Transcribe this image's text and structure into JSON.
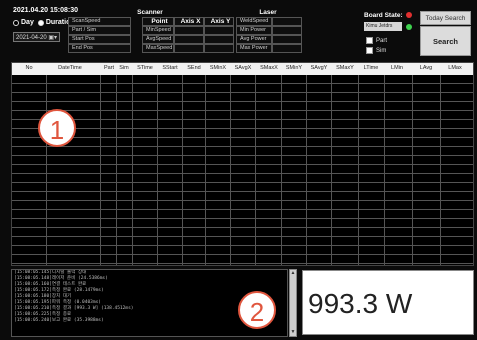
{
  "header": {
    "datetime": "2021.04.20 15:08:30",
    "mode_day": "Day",
    "mode_duration": "Duration",
    "date_value": "2021-04-20"
  },
  "scanner": {
    "title": "Scanner",
    "labels": [
      "ScanSpeed",
      "Part / Sim",
      "Start Pos",
      "End Pos"
    ],
    "col_point": "Point",
    "col_axisx": "Axis X",
    "col_axisy": "Axis Y",
    "speeds": [
      "MinSpeed",
      "AvgSpeed",
      "MaxSpeed"
    ]
  },
  "laser": {
    "title": "Laser",
    "labels": [
      "WeldSpeed",
      "Min Power",
      "Avg Power",
      "Max Power"
    ]
  },
  "board": {
    "label": "Board State:",
    "status": "Kimu Jetdrs",
    "chk_part": "Part",
    "chk_sim": "Sim",
    "red": "#e23030",
    "green": "#3ed24e"
  },
  "buttons": {
    "today": "Today Search",
    "search": "Search"
  },
  "table": {
    "columns": [
      "No",
      "DateTime",
      "Part",
      "Sim",
      "STime",
      "SStart",
      "SEnd",
      "SMinX",
      "SAvgX",
      "SMaxX",
      "SMinY",
      "SAvgY",
      "SMaxY",
      "LTime",
      "LMin",
      "LAvg",
      "LMax"
    ]
  },
  "log": {
    "lines": [
      "[15:08:05.145]디지털 출력 상태",
      "[15:08:05.148]레이저 준비 (24.5386ms)",
      "[15:08:05.160]연결 테스트 완료",
      "[15:08:05.172]측정 완료 (28.1479ms)",
      "[15:08:05.180]장치 대기",
      "[15:08:05.195]파워 측정 (0.0403ms)",
      "[15:08:05.210]측정 결과 [993.3 W] (138.4512ms)",
      "[15:08:05.225]측정 종료",
      "[15:08:05.240]보고 완료 (35.3988ms)"
    ]
  },
  "power": {
    "value": "993.3 W"
  },
  "annotations": {
    "one": "1",
    "two": "2",
    "color": "#e0563e"
  }
}
